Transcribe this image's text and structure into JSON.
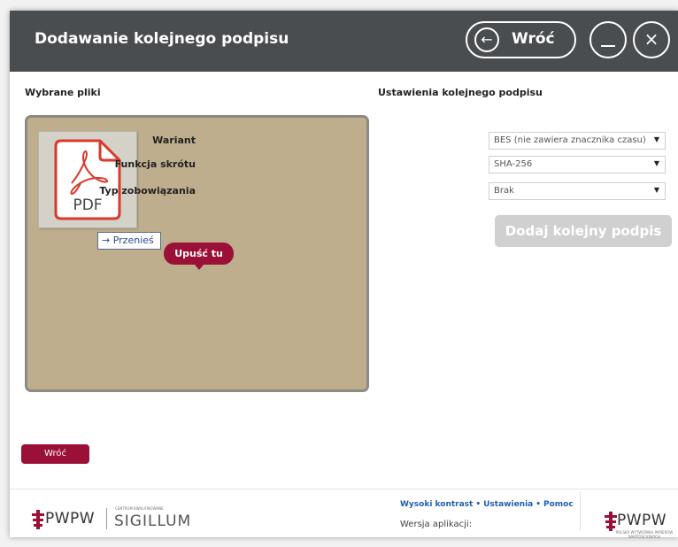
{
  "window": {
    "title": "Dodawanie kolejnego podpisu",
    "back_label": "Wróć"
  },
  "left": {
    "heading": "Wybrane pliki",
    "file_type": "PDF",
    "drag_tooltip": "Przenieś",
    "drag_arrow": "→",
    "drop_label": "Upuść tu",
    "back_label": "Wróć"
  },
  "right": {
    "heading": "Ustawienia kolejnego podpisu",
    "fields": [
      {
        "label": "Wariant",
        "value": "BES (nie zawiera znacznika czasu)"
      },
      {
        "label": "Funkcja skrótu",
        "value": "SHA-256"
      },
      {
        "label": "Typ zobowiązania",
        "value": "Brak"
      }
    ],
    "add_button": "Dodaj kolejny podpis"
  },
  "footer": {
    "logo_pwpw": "PWPW",
    "logo_sigillum_caption": "CENTRUM KWALIFIKOWANE",
    "logo_sigillum": "SIGILLUM",
    "links": [
      "Wysoki kontrast",
      "Ustawienia",
      "Pomoc"
    ],
    "version": "Wersja aplikacji:",
    "logo_right_caption": "POLSKA WYTWÓRNIA PAPIERÓW WARTOŚCIOWYCH"
  },
  "colors": {
    "titlebar": "#4a4d50",
    "accent": "#9b1036",
    "dropzone": "#bfae8e",
    "link": "#1f5fb0"
  },
  "icons": [
    "back-arrow-icon",
    "minimize-icon",
    "close-icon",
    "pdf-file-icon",
    "pwpw-logo-icon"
  ]
}
